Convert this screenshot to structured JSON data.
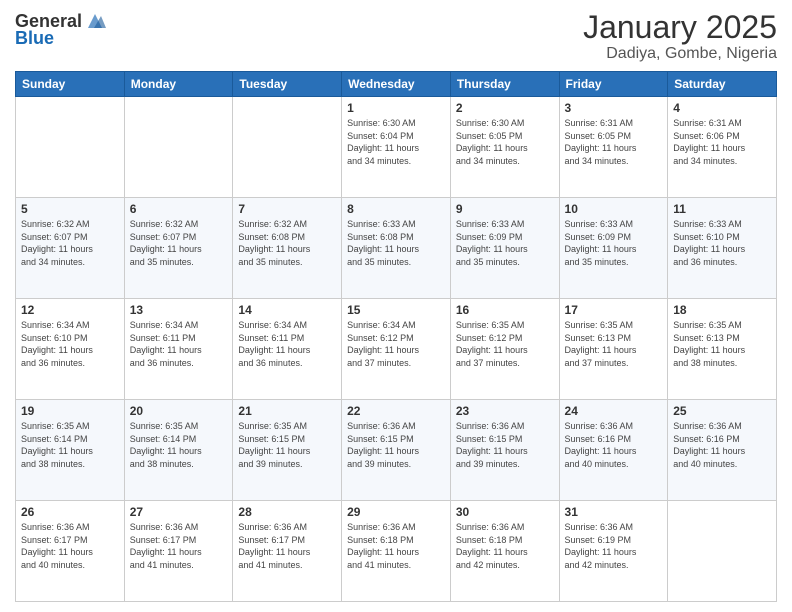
{
  "header": {
    "logo_general": "General",
    "logo_blue": "Blue",
    "month_title": "January 2025",
    "location": "Dadiya, Gombe, Nigeria"
  },
  "days_of_week": [
    "Sunday",
    "Monday",
    "Tuesday",
    "Wednesday",
    "Thursday",
    "Friday",
    "Saturday"
  ],
  "weeks": [
    [
      {
        "day": "",
        "info": ""
      },
      {
        "day": "",
        "info": ""
      },
      {
        "day": "",
        "info": ""
      },
      {
        "day": "1",
        "info": "Sunrise: 6:30 AM\nSunset: 6:04 PM\nDaylight: 11 hours\nand 34 minutes."
      },
      {
        "day": "2",
        "info": "Sunrise: 6:30 AM\nSunset: 6:05 PM\nDaylight: 11 hours\nand 34 minutes."
      },
      {
        "day": "3",
        "info": "Sunrise: 6:31 AM\nSunset: 6:05 PM\nDaylight: 11 hours\nand 34 minutes."
      },
      {
        "day": "4",
        "info": "Sunrise: 6:31 AM\nSunset: 6:06 PM\nDaylight: 11 hours\nand 34 minutes."
      }
    ],
    [
      {
        "day": "5",
        "info": "Sunrise: 6:32 AM\nSunset: 6:07 PM\nDaylight: 11 hours\nand 34 minutes."
      },
      {
        "day": "6",
        "info": "Sunrise: 6:32 AM\nSunset: 6:07 PM\nDaylight: 11 hours\nand 35 minutes."
      },
      {
        "day": "7",
        "info": "Sunrise: 6:32 AM\nSunset: 6:08 PM\nDaylight: 11 hours\nand 35 minutes."
      },
      {
        "day": "8",
        "info": "Sunrise: 6:33 AM\nSunset: 6:08 PM\nDaylight: 11 hours\nand 35 minutes."
      },
      {
        "day": "9",
        "info": "Sunrise: 6:33 AM\nSunset: 6:09 PM\nDaylight: 11 hours\nand 35 minutes."
      },
      {
        "day": "10",
        "info": "Sunrise: 6:33 AM\nSunset: 6:09 PM\nDaylight: 11 hours\nand 35 minutes."
      },
      {
        "day": "11",
        "info": "Sunrise: 6:33 AM\nSunset: 6:10 PM\nDaylight: 11 hours\nand 36 minutes."
      }
    ],
    [
      {
        "day": "12",
        "info": "Sunrise: 6:34 AM\nSunset: 6:10 PM\nDaylight: 11 hours\nand 36 minutes."
      },
      {
        "day": "13",
        "info": "Sunrise: 6:34 AM\nSunset: 6:11 PM\nDaylight: 11 hours\nand 36 minutes."
      },
      {
        "day": "14",
        "info": "Sunrise: 6:34 AM\nSunset: 6:11 PM\nDaylight: 11 hours\nand 36 minutes."
      },
      {
        "day": "15",
        "info": "Sunrise: 6:34 AM\nSunset: 6:12 PM\nDaylight: 11 hours\nand 37 minutes."
      },
      {
        "day": "16",
        "info": "Sunrise: 6:35 AM\nSunset: 6:12 PM\nDaylight: 11 hours\nand 37 minutes."
      },
      {
        "day": "17",
        "info": "Sunrise: 6:35 AM\nSunset: 6:13 PM\nDaylight: 11 hours\nand 37 minutes."
      },
      {
        "day": "18",
        "info": "Sunrise: 6:35 AM\nSunset: 6:13 PM\nDaylight: 11 hours\nand 38 minutes."
      }
    ],
    [
      {
        "day": "19",
        "info": "Sunrise: 6:35 AM\nSunset: 6:14 PM\nDaylight: 11 hours\nand 38 minutes."
      },
      {
        "day": "20",
        "info": "Sunrise: 6:35 AM\nSunset: 6:14 PM\nDaylight: 11 hours\nand 38 minutes."
      },
      {
        "day": "21",
        "info": "Sunrise: 6:35 AM\nSunset: 6:15 PM\nDaylight: 11 hours\nand 39 minutes."
      },
      {
        "day": "22",
        "info": "Sunrise: 6:36 AM\nSunset: 6:15 PM\nDaylight: 11 hours\nand 39 minutes."
      },
      {
        "day": "23",
        "info": "Sunrise: 6:36 AM\nSunset: 6:15 PM\nDaylight: 11 hours\nand 39 minutes."
      },
      {
        "day": "24",
        "info": "Sunrise: 6:36 AM\nSunset: 6:16 PM\nDaylight: 11 hours\nand 40 minutes."
      },
      {
        "day": "25",
        "info": "Sunrise: 6:36 AM\nSunset: 6:16 PM\nDaylight: 11 hours\nand 40 minutes."
      }
    ],
    [
      {
        "day": "26",
        "info": "Sunrise: 6:36 AM\nSunset: 6:17 PM\nDaylight: 11 hours\nand 40 minutes."
      },
      {
        "day": "27",
        "info": "Sunrise: 6:36 AM\nSunset: 6:17 PM\nDaylight: 11 hours\nand 41 minutes."
      },
      {
        "day": "28",
        "info": "Sunrise: 6:36 AM\nSunset: 6:17 PM\nDaylight: 11 hours\nand 41 minutes."
      },
      {
        "day": "29",
        "info": "Sunrise: 6:36 AM\nSunset: 6:18 PM\nDaylight: 11 hours\nand 41 minutes."
      },
      {
        "day": "30",
        "info": "Sunrise: 6:36 AM\nSunset: 6:18 PM\nDaylight: 11 hours\nand 42 minutes."
      },
      {
        "day": "31",
        "info": "Sunrise: 6:36 AM\nSunset: 6:19 PM\nDaylight: 11 hours\nand 42 minutes."
      },
      {
        "day": "",
        "info": ""
      }
    ]
  ]
}
